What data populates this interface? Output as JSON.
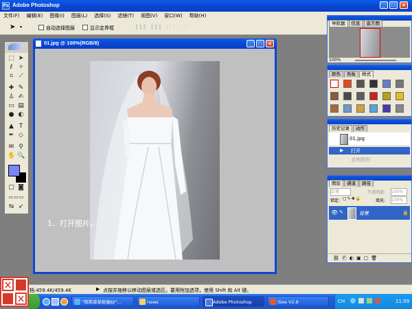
{
  "app": {
    "title": "Adobe Photoshop"
  },
  "menu": [
    "文件(F)",
    "编辑(E)",
    "图像(I)",
    "图层(L)",
    "选择(S)",
    "滤镜(T)",
    "视图(V)",
    "窗口(W)",
    "帮助(H)"
  ],
  "options": {
    "auto_select": "自动选择图层",
    "show_bounds": "显示定界框"
  },
  "document": {
    "title": "01.jpg @ 100%(RGB/8)",
    "caption": "1、打开图片。"
  },
  "navigator": {
    "tabs": [
      "导航器",
      "信息",
      "直方图"
    ],
    "zoom": "100%"
  },
  "swatches": {
    "tabs": [
      "颜色",
      "色板",
      "样式"
    ]
  },
  "history": {
    "tabs": [
      "历史记录",
      "动作"
    ],
    "snapshot": "01.jpg",
    "items": [
      "打开",
      "定制图形"
    ]
  },
  "layers": {
    "tabs": [
      "图层",
      "通道",
      "路径"
    ],
    "blend_mode": "正常",
    "opacity_label": "不透明度:",
    "opacity": "100%",
    "lock_label": "锁定:",
    "fill_label": "填充:",
    "fill": "100%",
    "layer_name": "背景"
  },
  "status": {
    "doc_size": "文档:459.4K/459.4K",
    "hint": "点按并拖移以移动图层或选区。要用附加选项，使用 Shift 和 Alt 键。"
  },
  "taskbar": {
    "items": [
      "\"简简单单抠婚纱\"...",
      "news",
      "Adobe Photoshop",
      "iSee V2.8"
    ],
    "lang": "CH",
    "clock": "11:59"
  },
  "colors": {
    "xp_blue": "#0b47d4",
    "foreground": "#7a85f5",
    "background": "#000000",
    "taskbar_start": "#3a9a2f",
    "watermark": "#d43a2a"
  }
}
